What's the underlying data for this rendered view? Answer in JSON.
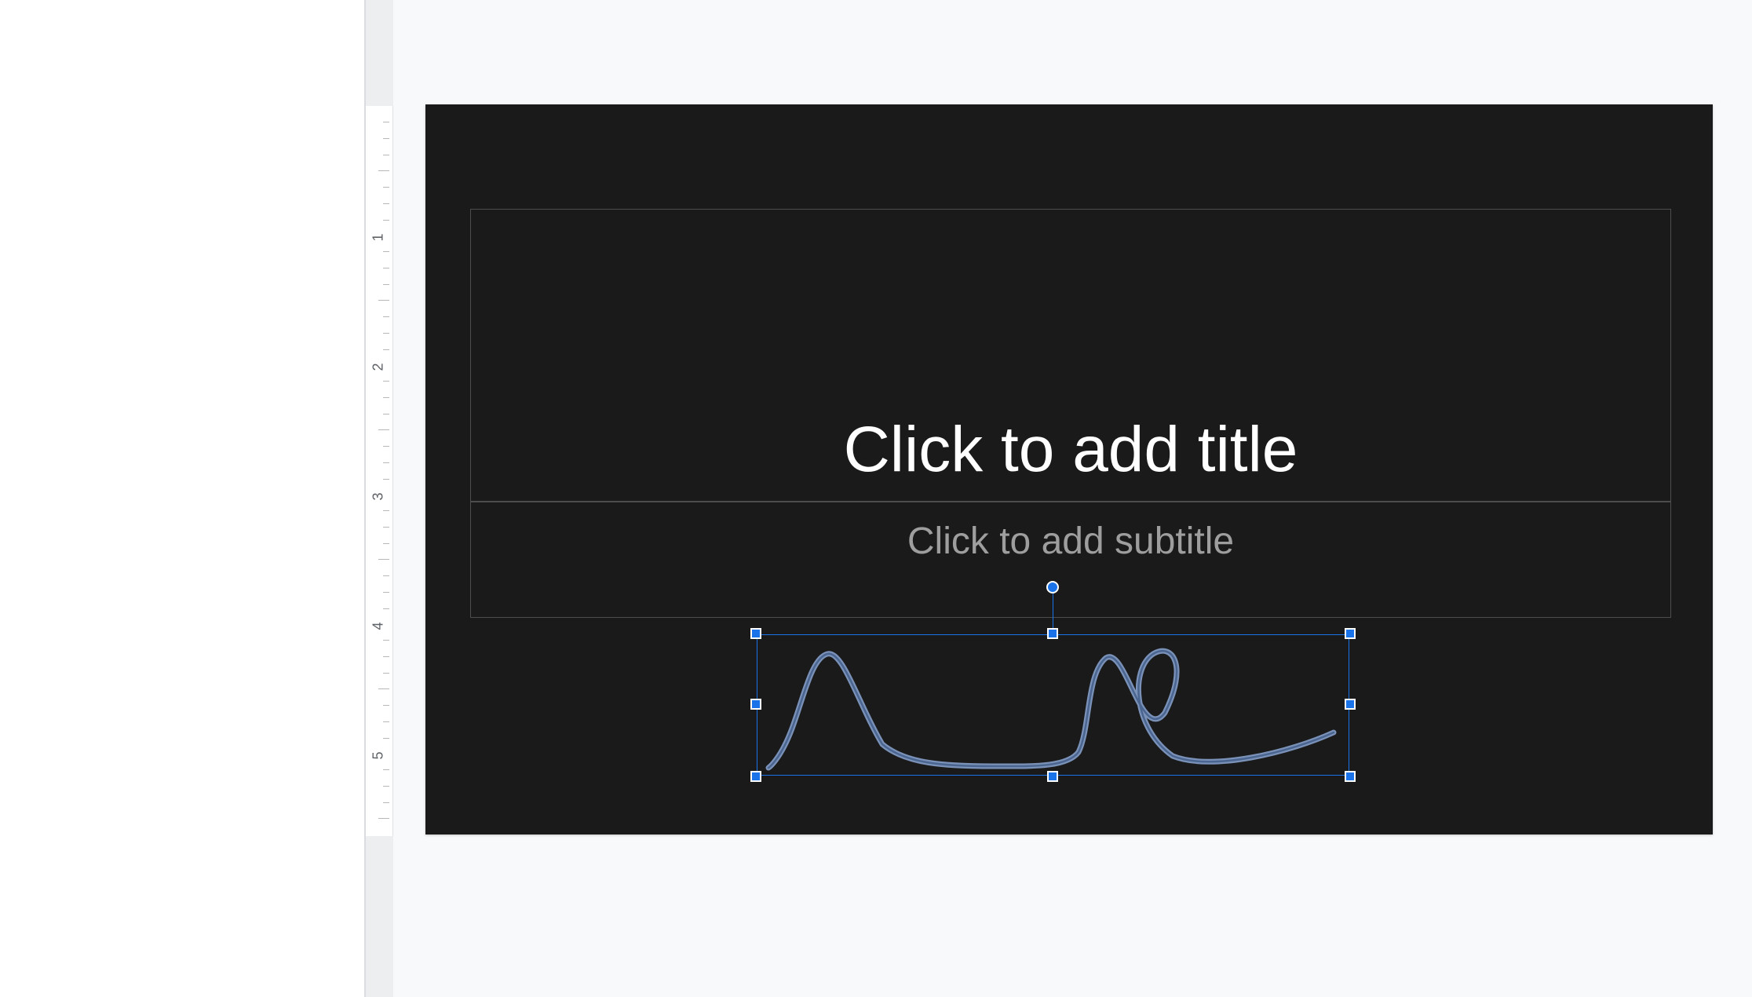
{
  "slide": {
    "title_placeholder": "Click to add title",
    "subtitle_placeholder": "Click to add subtitle",
    "background_color": "#1a1a1a"
  },
  "ruler": {
    "labels": [
      "1",
      "2",
      "3",
      "4",
      "5"
    ]
  },
  "selection": {
    "shape_type": "scribble",
    "stroke_color": "#5b7aa8",
    "handle_color": "#1a73e8"
  }
}
